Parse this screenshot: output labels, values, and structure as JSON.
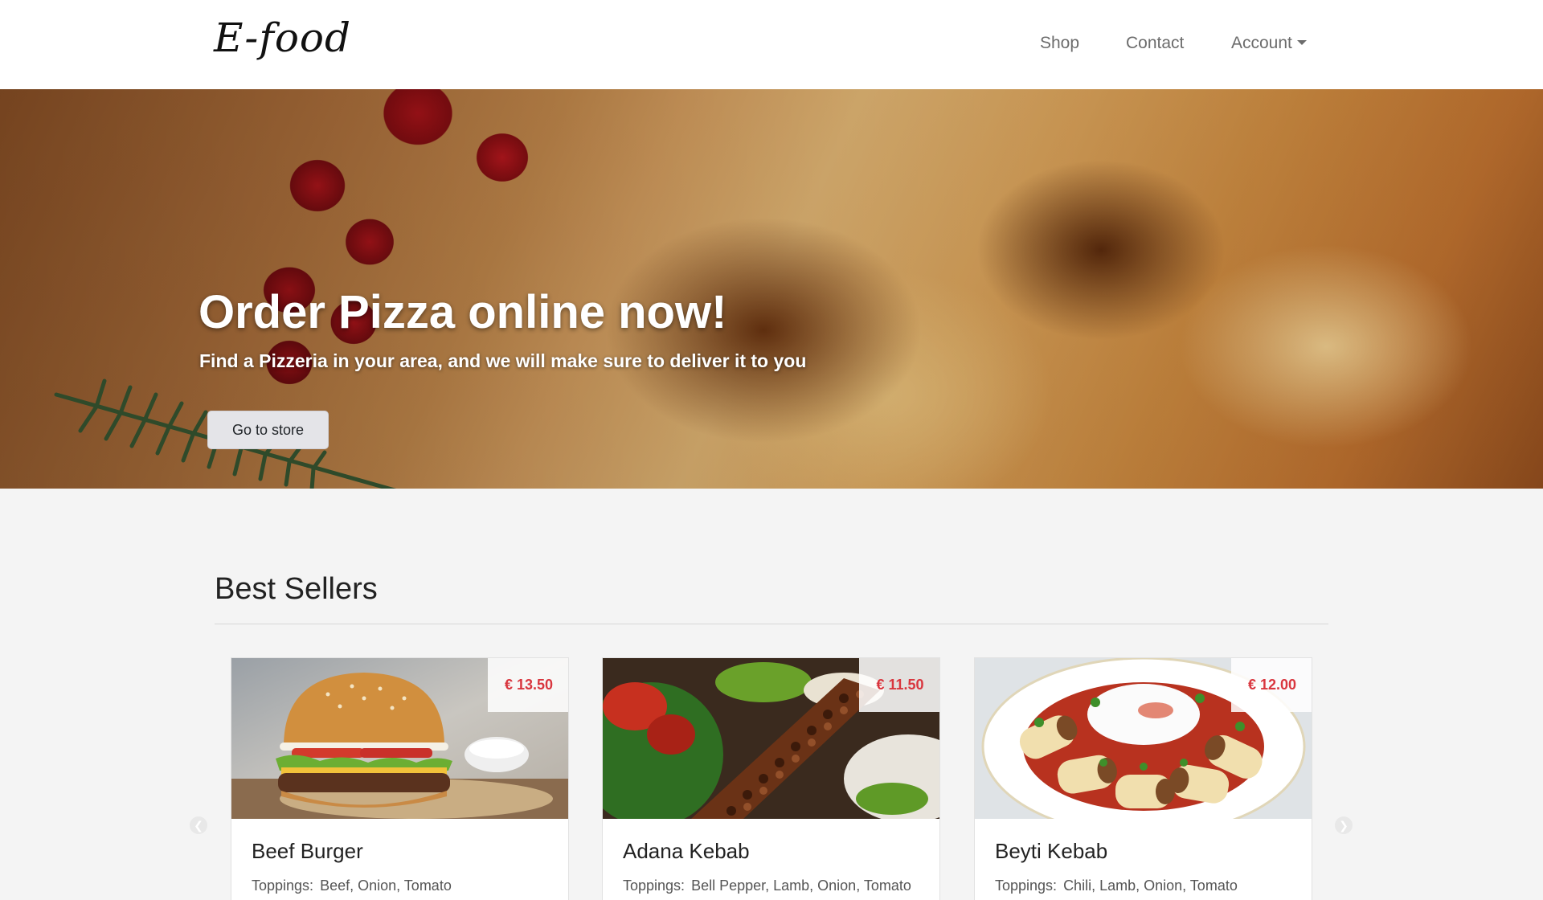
{
  "navbar": {
    "brand": "E-food",
    "links": [
      {
        "label": "Shop"
      },
      {
        "label": "Contact"
      },
      {
        "label": "Account"
      }
    ]
  },
  "hero": {
    "title": "Order Pizza online now!",
    "subtitle": "Find a Pizzeria in your area, and we will make sure to deliver it to you",
    "button_label": "Go to store"
  },
  "best_sellers": {
    "title": "Best Sellers",
    "toppings_label": "Toppings:",
    "items": [
      {
        "name": "Beef Burger",
        "price": "€ 13.50",
        "toppings": "Beef, Onion, Tomato"
      },
      {
        "name": "Adana Kebab",
        "price": "€ 11.50",
        "toppings": "Bell Pepper, Lamb, Onion, Tomato"
      },
      {
        "name": "Beyti Kebab",
        "price": "€ 12.00",
        "toppings": "Chili, Lamb, Onion, Tomato"
      }
    ]
  },
  "carousel": {
    "prev_icon": "chevron-left-icon",
    "next_icon": "chevron-right-icon"
  },
  "colors": {
    "price": "#d9363e",
    "nav_link": "#6c6c6c",
    "page_bg": "#f4f4f4"
  }
}
